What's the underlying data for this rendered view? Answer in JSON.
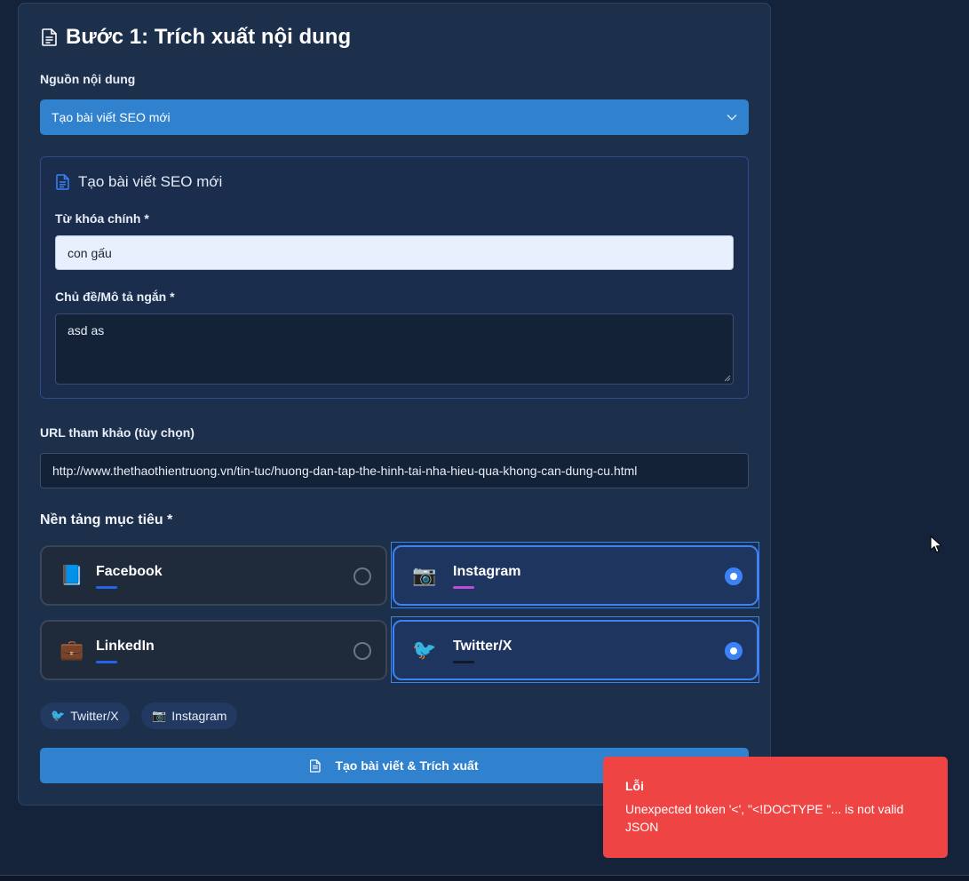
{
  "step": {
    "title": "Bước 1: Trích xuất nội dung"
  },
  "source": {
    "label": "Nguồn nội dung",
    "selected": "Tạo bài viết SEO mới"
  },
  "seo_form": {
    "title": "Tạo bài viết SEO mới",
    "keyword_label": "Từ khóa chính *",
    "keyword_value": "con gấu",
    "topic_label": "Chủ đề/Mô tả ngắn *",
    "topic_value": "asd as"
  },
  "reference": {
    "label": "URL tham khảo (tùy chọn)",
    "url_value": "http://www.thethaothientruong.vn/tin-tuc/huong-dan-tap-the-hinh-tai-nha-hieu-qua-khong-can-dung-cu.html"
  },
  "platforms": {
    "label": "Nền tảng mục tiêu *",
    "items": [
      {
        "name": "Facebook",
        "emoji": "📘",
        "selected": false,
        "bar_color": "#2563eb"
      },
      {
        "name": "Instagram",
        "emoji": "📷",
        "selected": true,
        "bar_color": "#c04bd8"
      },
      {
        "name": "LinkedIn",
        "emoji": "💼",
        "selected": false,
        "bar_color": "#2563eb"
      },
      {
        "name": "Twitter/X",
        "emoji": "🐦",
        "selected": true,
        "bar_color": "#111827"
      }
    ]
  },
  "chips": [
    {
      "label": "Twitter/X",
      "emoji": "🐦"
    },
    {
      "label": "Instagram",
      "emoji": "📷"
    }
  ],
  "submit": {
    "label": "Tạo bài viết & Trích xuất"
  },
  "toast": {
    "title": "Lỗi",
    "message": "Unexpected token '<', \"<!DOCTYPE \"... is not valid JSON"
  },
  "colors": {
    "accent": "#3182ce",
    "selected_border": "#3b82f6",
    "error": "#ef4444"
  }
}
